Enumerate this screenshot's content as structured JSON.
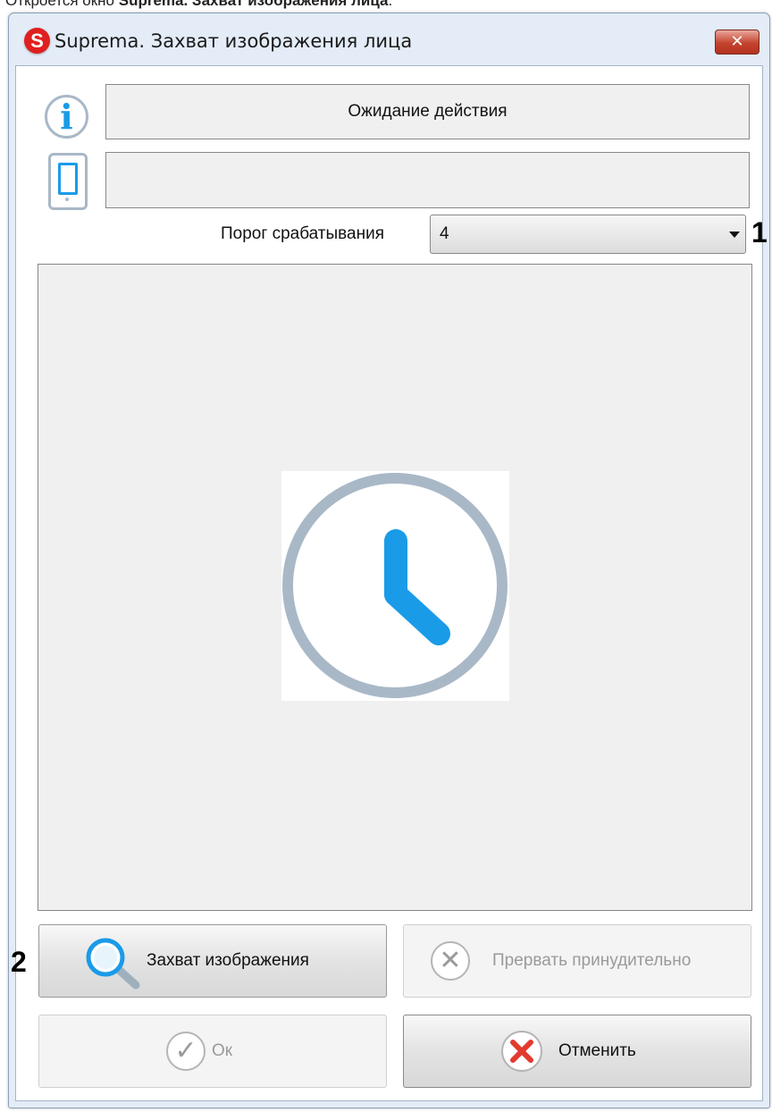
{
  "caption": {
    "prefix": "Откроется окно ",
    "bold": "Suprema. Захват изображения лица",
    "suffix": "."
  },
  "window": {
    "title": "Suprema. Захват изображения лица",
    "app_icon_letter": "S",
    "close_glyph": "✕"
  },
  "status": {
    "message": "Ожидание действия",
    "device_message": ""
  },
  "threshold": {
    "label": "Порог срабатывания",
    "value": "4"
  },
  "markers": {
    "threshold": "1",
    "capture": "2"
  },
  "buttons": {
    "capture": "Захват изображения",
    "abort": "Прервать принудительно",
    "ok": "Ок",
    "cancel": "Отменить"
  },
  "colors": {
    "accent_blue": "#1a9be8",
    "icon_gray": "#a9b8c7",
    "cancel_red": "#e23b2e"
  },
  "icons": {
    "info": "info-icon",
    "device": "tablet-icon",
    "preview": "clock-icon",
    "capture": "magnifier-icon",
    "abort": "close-circle-icon",
    "ok": "checkmark-icon",
    "cancel": "close-red-icon"
  }
}
